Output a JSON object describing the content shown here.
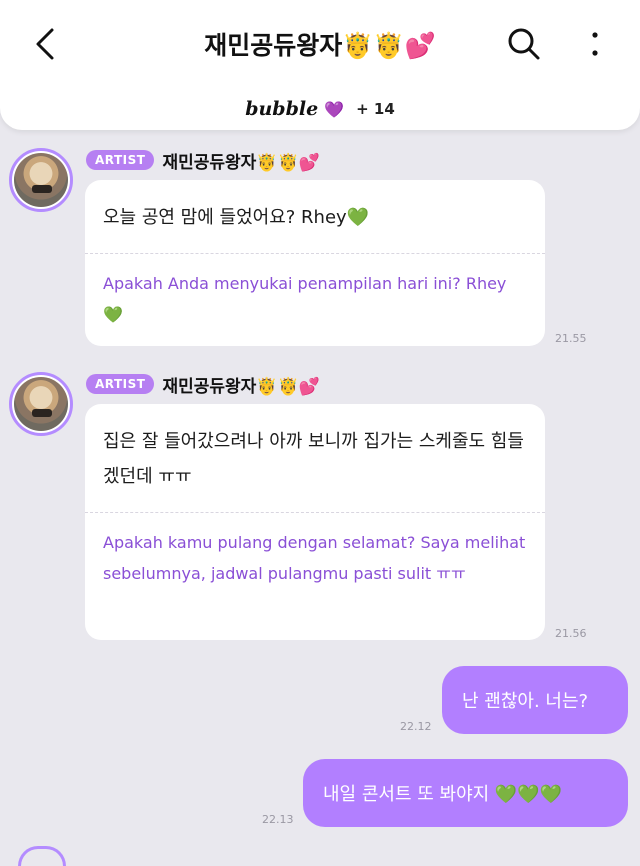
{
  "header": {
    "title": "재민공듀왕자🤴🤴💕",
    "bubble_label": "bubble",
    "bubble_heart": "💜",
    "bubble_count": "+ 14"
  },
  "messages": [
    {
      "badge": "ARTIST",
      "sender": "재민공듀왕자🤴🤴💕",
      "text": "오늘 공연 맘에 들었어요? Rhey💚",
      "translation": "Apakah Anda menyukai penampilan hari ini? Rhey 💚",
      "time": "21.55"
    },
    {
      "badge": "ARTIST",
      "sender": "재민공듀왕자🤴🤴💕",
      "text": "집은 잘 들어갔으려나 아까 보니까 집가는 스케줄도 힘들겠던데 ㅠㅠ",
      "translation": "Apakah kamu pulang dengan selamat? Saya melihat sebelumnya, jadwal pulangmu pasti sulit ㅠㅠ",
      "time": "21.56"
    }
  ],
  "my_messages": [
    {
      "text": "난 괜찮아. 너는?",
      "time": "22.12"
    },
    {
      "text": "내일 콘서트 또 봐야지 💚💚💚",
      "time": "22.13"
    }
  ],
  "colors": {
    "accent": "#b27fff",
    "badge": "#b67ff2",
    "translation": "#8a4fd6",
    "background": "#e9e8ee"
  },
  "icons": {
    "back": "back-arrow-icon",
    "search": "search-icon",
    "more": "more-vertical-icon"
  }
}
